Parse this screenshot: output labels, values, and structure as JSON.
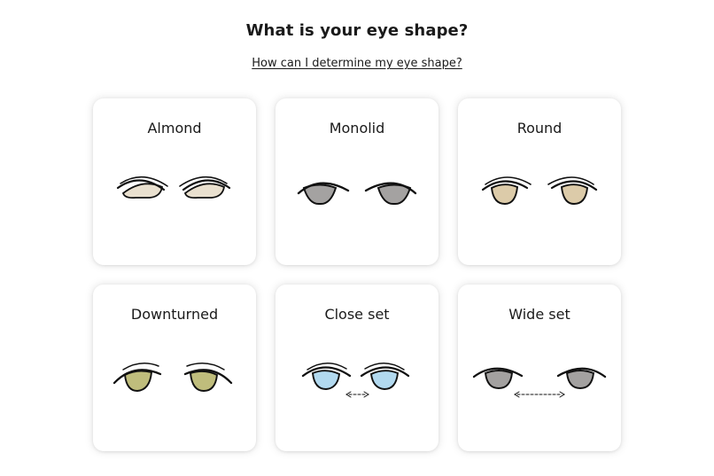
{
  "header": {
    "title": "What is your eye shape?",
    "help_link": "How can I determine my eye shape?"
  },
  "options": [
    {
      "label": "Almond",
      "icon": "almond-eyes-icon",
      "iris_color": "#e9e0cf"
    },
    {
      "label": "Monolid",
      "icon": "monolid-eyes-icon",
      "iris_color": "#a4a2a1"
    },
    {
      "label": "Round",
      "icon": "round-eyes-icon",
      "iris_color": "#dccba9"
    },
    {
      "label": "Downturned",
      "icon": "downturned-eyes-icon",
      "iris_color": "#bfbd7c"
    },
    {
      "label": "Close set",
      "icon": "close-set-eyes-icon",
      "iris_color": "#b2d9ef"
    },
    {
      "label": "Wide set",
      "icon": "wide-set-eyes-icon",
      "iris_color": "#a3a1a0"
    }
  ]
}
